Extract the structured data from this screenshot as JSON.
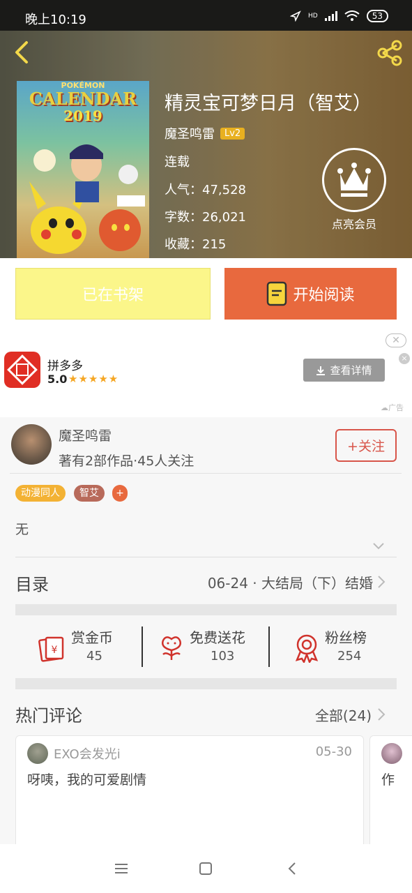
{
  "status_bar": {
    "time": "晚上10:19",
    "network": "HD",
    "battery": "53"
  },
  "header": {
    "back_icon": "back-arrow-icon",
    "share_icon": "share-icon"
  },
  "cover": {
    "line1": "POKÉMON",
    "line2": "CALENDAR",
    "line3": "2019"
  },
  "book": {
    "title": "精灵宝可梦日月（智艾）",
    "author": "魔圣鸣雷",
    "level": "Lv2",
    "status": "连载",
    "popularity": "人气：47,528",
    "word_count": "字数：26,021",
    "favorites": "收藏：215"
  },
  "vip": {
    "label": "点亮会员",
    "icon": "crown-icon"
  },
  "actions": {
    "shelf_label": "已在书架",
    "read_label": "开始阅读",
    "read_icon": "book-icon"
  },
  "ad": {
    "app_name": "拼多多",
    "rating": "5.0",
    "stars": "★★★★★",
    "button_label": "查看详情",
    "tag": "广告",
    "close": "✕",
    "dismiss": "×"
  },
  "author_block": {
    "name": "魔圣鸣雷",
    "meta": "著有2部作品·45人关注",
    "follow_label": "+关注"
  },
  "tags": [
    {
      "label": "动漫同人",
      "color": "#f3b234"
    },
    {
      "label": "智艾",
      "color": "#b86a5a"
    },
    {
      "label": "+",
      "color": "#e8693e"
    }
  ],
  "description": "无",
  "toc": {
    "label": "目录",
    "latest": "06-24 · 大结局（下）结婚"
  },
  "stats": [
    {
      "label": "赏金币",
      "value": "45",
      "icon": "red-envelope-icon"
    },
    {
      "label": "免费送花",
      "value": "103",
      "icon": "flower-icon"
    },
    {
      "label": "粉丝榜",
      "value": "254",
      "icon": "medal-icon"
    }
  ],
  "comments": {
    "title": "热门评论",
    "all_label": "全部(24)",
    "items": [
      {
        "user": "EXO会发光i",
        "date": "05-30",
        "text": "呀咦，我的可爱剧情"
      },
      {
        "user": "",
        "date": "",
        "text": "作"
      }
    ]
  },
  "navbar": {
    "menu_icon": "menu-icon",
    "home_icon": "home-square-icon",
    "back_icon": "nav-back-icon"
  },
  "colors": {
    "accent": "#e8693e",
    "shelf": "#fbf68a",
    "follow": "#d8554a",
    "stat_icon": "#d0332c"
  }
}
